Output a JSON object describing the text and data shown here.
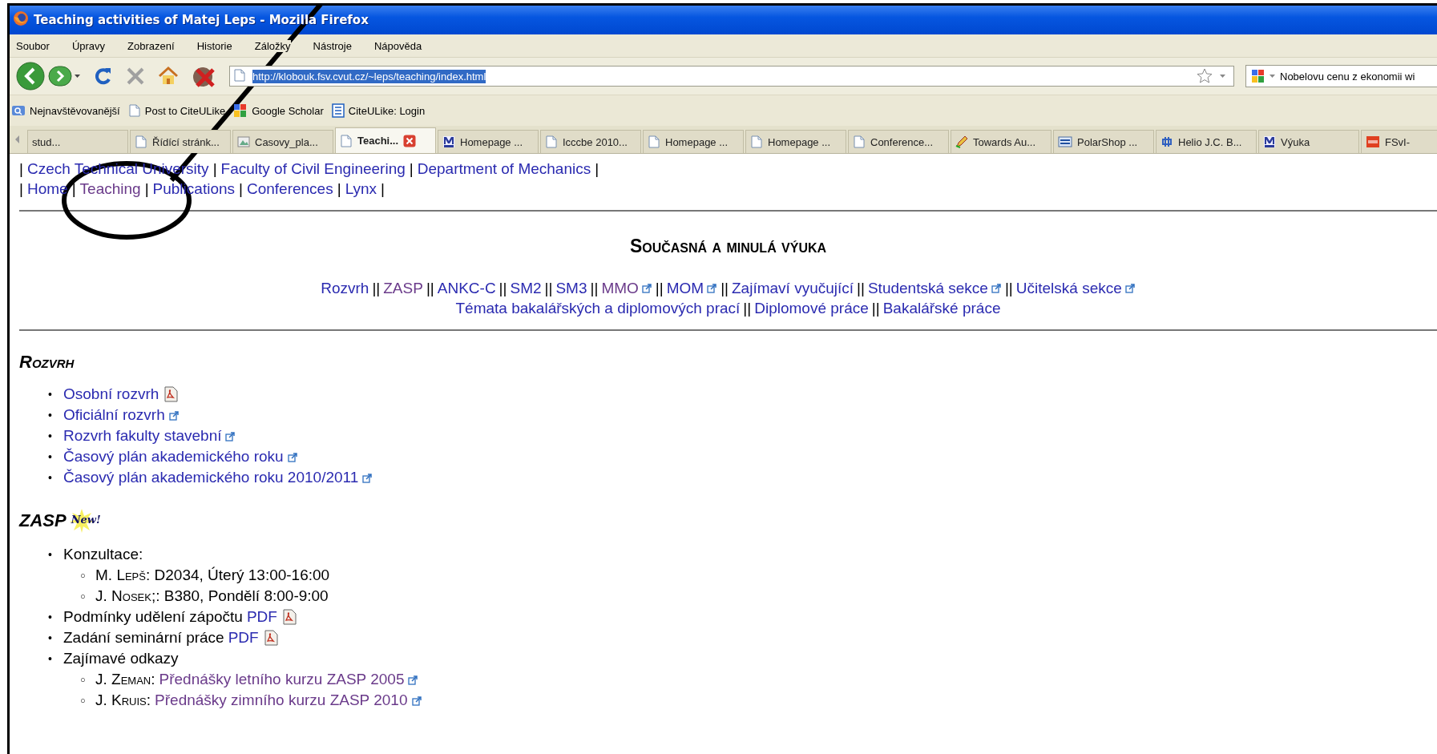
{
  "window": {
    "title": "Teaching activities of Matej Leps - Mozilla Firefox"
  },
  "menu": [
    "Soubor",
    "Úpravy",
    "Zobrazení",
    "Historie",
    "Záložky",
    "Nástroje",
    "Nápověda"
  ],
  "address": {
    "value": "http://klobouk.fsv.cvut.cz/~leps/teaching/index.html"
  },
  "search": {
    "value": "Nobelovu cenu z ekonomii wi"
  },
  "bookmarks": [
    {
      "label": "Nejnavštěvovanější",
      "kind": "folder"
    },
    {
      "label": "Post to CiteULike",
      "kind": "page"
    },
    {
      "label": "Google Scholar",
      "kind": "google"
    },
    {
      "label": "CiteULike: Login",
      "kind": "list"
    }
  ],
  "tabs": [
    {
      "label": "stud...",
      "selected": false
    },
    {
      "label": "Řídící stránk...",
      "kind": "page",
      "selected": false
    },
    {
      "label": "Casovy_pla...",
      "kind": "image",
      "selected": false
    },
    {
      "label": "Teachi...",
      "kind": "page",
      "selected": true
    },
    {
      "label": "Homepage ...",
      "kind": "m",
      "selected": false
    },
    {
      "label": "Icccbe 2010...",
      "kind": "page",
      "selected": false
    },
    {
      "label": "Homepage ...",
      "kind": "page",
      "selected": false
    },
    {
      "label": "Homepage ...",
      "kind": "page",
      "selected": false
    },
    {
      "label": "Conference...",
      "kind": "page",
      "selected": false
    },
    {
      "label": "Towards Au...",
      "kind": "pencil",
      "selected": false
    },
    {
      "label": "PolarShop ...",
      "kind": "polar",
      "selected": false
    },
    {
      "label": "Helio J.C. B...",
      "kind": "helio",
      "selected": false
    },
    {
      "label": "Výuka",
      "kind": "m",
      "selected": false
    },
    {
      "label": "FSvI-",
      "kind": "fsv",
      "selected": false
    }
  ],
  "site_nav": [
    [
      {
        "kind": "sep",
        "text": "|"
      },
      {
        "kind": "link",
        "text": "Czech Technical University",
        "visited": false
      },
      {
        "kind": "sep",
        "text": "|"
      },
      {
        "kind": "link",
        "text": "Faculty of Civil Engineering",
        "visited": false
      },
      {
        "kind": "sep",
        "text": "|"
      },
      {
        "kind": "link",
        "text": "Department of Mechanics",
        "visited": false
      },
      {
        "kind": "sep",
        "text": "|"
      }
    ],
    [
      {
        "kind": "sep",
        "text": "|"
      },
      {
        "kind": "link",
        "text": "Home",
        "visited": false
      },
      {
        "kind": "sep",
        "text": "|"
      },
      {
        "kind": "link",
        "text": "Teaching",
        "visited": true
      },
      {
        "kind": "sep",
        "text": "|"
      },
      {
        "kind": "link",
        "text": "Publications",
        "visited": false
      },
      {
        "kind": "sep",
        "text": "|"
      },
      {
        "kind": "link",
        "text": "Conferences",
        "visited": false
      },
      {
        "kind": "sep",
        "text": "|"
      },
      {
        "kind": "link",
        "text": "Lynx",
        "visited": false
      },
      {
        "kind": "sep",
        "text": "|"
      }
    ]
  ],
  "heading": "Současná a minulá výuka",
  "section_nav": [
    [
      {
        "kind": "link",
        "text": "Rozvrh",
        "visited": false
      },
      {
        "kind": "sep",
        "text": "||"
      },
      {
        "kind": "link",
        "text": "ZASP",
        "visited": true
      },
      {
        "kind": "sep",
        "text": "||"
      },
      {
        "kind": "link",
        "text": "ANKC-C",
        "visited": false
      },
      {
        "kind": "sep",
        "text": "||"
      },
      {
        "kind": "link",
        "text": "SM2",
        "visited": false
      },
      {
        "kind": "sep",
        "text": "||"
      },
      {
        "kind": "link",
        "text": "SM3",
        "visited": false
      },
      {
        "kind": "sep",
        "text": "||"
      },
      {
        "kind": "external",
        "text": "MMO",
        "visited": true
      },
      {
        "kind": "sep",
        "text": "||"
      },
      {
        "kind": "external",
        "text": "MOM",
        "visited": false
      },
      {
        "kind": "sep",
        "text": "||"
      },
      {
        "kind": "link",
        "text": "Zajímaví vyučující",
        "visited": false
      },
      {
        "kind": "sep",
        "text": "||"
      },
      {
        "kind": "external",
        "text": "Studentská sekce",
        "visited": false
      },
      {
        "kind": "sep",
        "text": "||"
      },
      {
        "kind": "external",
        "text": "Učitelská sekce",
        "visited": false
      }
    ],
    [
      {
        "kind": "link",
        "text": "Témata bakalářských a diplomových prací",
        "visited": false
      },
      {
        "kind": "sep",
        "text": "||"
      },
      {
        "kind": "link",
        "text": "Diplomové práce",
        "visited": false
      },
      {
        "kind": "sep",
        "text": "||"
      },
      {
        "kind": "link",
        "text": "Bakalářské práce",
        "visited": false
      }
    ]
  ],
  "sections": [
    {
      "title": "Rozvrh",
      "items": [
        {
          "marker": "•",
          "link": {
            "text": "Osobní rozvrh",
            "visited": false,
            "kind": "pdf"
          }
        },
        {
          "marker": "•",
          "link": {
            "text": "Oficiální rozvrh",
            "visited": false,
            "kind": "external"
          }
        },
        {
          "marker": "•",
          "link": {
            "text": "Rozvrh fakulty stavební",
            "visited": false,
            "kind": "external"
          }
        },
        {
          "marker": "•",
          "link": {
            "text": "Časový plán akademického roku",
            "visited": false,
            "kind": "external"
          }
        },
        {
          "marker": "•",
          "link": {
            "text": "Časový plán akademického roku 2010/2011",
            "visited": false,
            "kind": "external"
          }
        }
      ]
    },
    {
      "title": "ZASP",
      "badge": "New!",
      "items": [
        {
          "marker": "•",
          "text": "Konzultace:",
          "children": [
            {
              "marker": "○",
              "name": "M. Lepš",
              "text": ": D2034, Úterý 13:00-16:00"
            },
            {
              "marker": "○",
              "name": "J. Nosek;",
              "text": ": B380, Pondělí 8:00-9:00"
            }
          ]
        },
        {
          "marker": "•",
          "text": "Podmínky udělení zápočtu",
          "link": {
            "text": "PDF",
            "visited": false,
            "kind": "pdf"
          }
        },
        {
          "marker": "•",
          "text": "Zadání seminární práce",
          "link": {
            "text": "PDF",
            "visited": false,
            "kind": "pdf"
          }
        },
        {
          "marker": "•",
          "text": "Zajímavé odkazy",
          "children": [
            {
              "marker": "○",
              "name": "J. Zeman",
              "text": ":",
              "link": {
                "text": "Přednášky letního kurzu ZASP 2005",
                "visited": true,
                "kind": "external"
              }
            },
            {
              "marker": "○",
              "name": "J. Kruis",
              "text": ":",
              "link": {
                "text": "Přednášky zimního kurzu ZASP 2010",
                "visited": true,
                "kind": "external"
              }
            }
          ]
        }
      ]
    }
  ]
}
